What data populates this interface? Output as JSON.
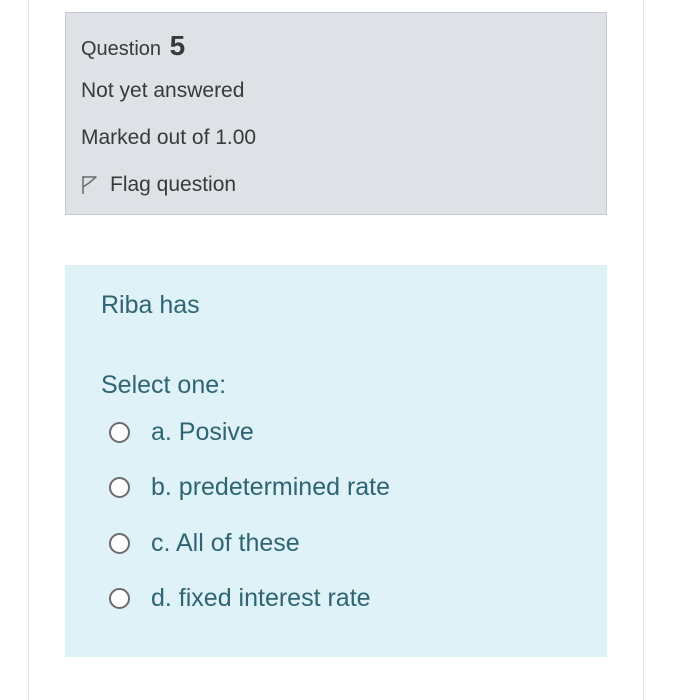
{
  "info": {
    "question_label": "Question",
    "question_number": "5",
    "state": "Not yet answered",
    "grade": "Marked out of 1.00",
    "flag_label": "Flag question",
    "flag_icon": "flag-outline-icon"
  },
  "question": {
    "text": "Riba has",
    "prompt": "Select one:",
    "options": [
      {
        "label": "a. Posive",
        "selected": false
      },
      {
        "label": "b. predetermined rate",
        "selected": false
      },
      {
        "label": "c. All of these",
        "selected": false
      },
      {
        "label": "d. fixed interest rate",
        "selected": false
      }
    ]
  },
  "colors": {
    "info_bg": "#dee2e6",
    "content_bg": "#def2f8",
    "content_text": "#2f6473",
    "info_text": "#373a3c"
  }
}
